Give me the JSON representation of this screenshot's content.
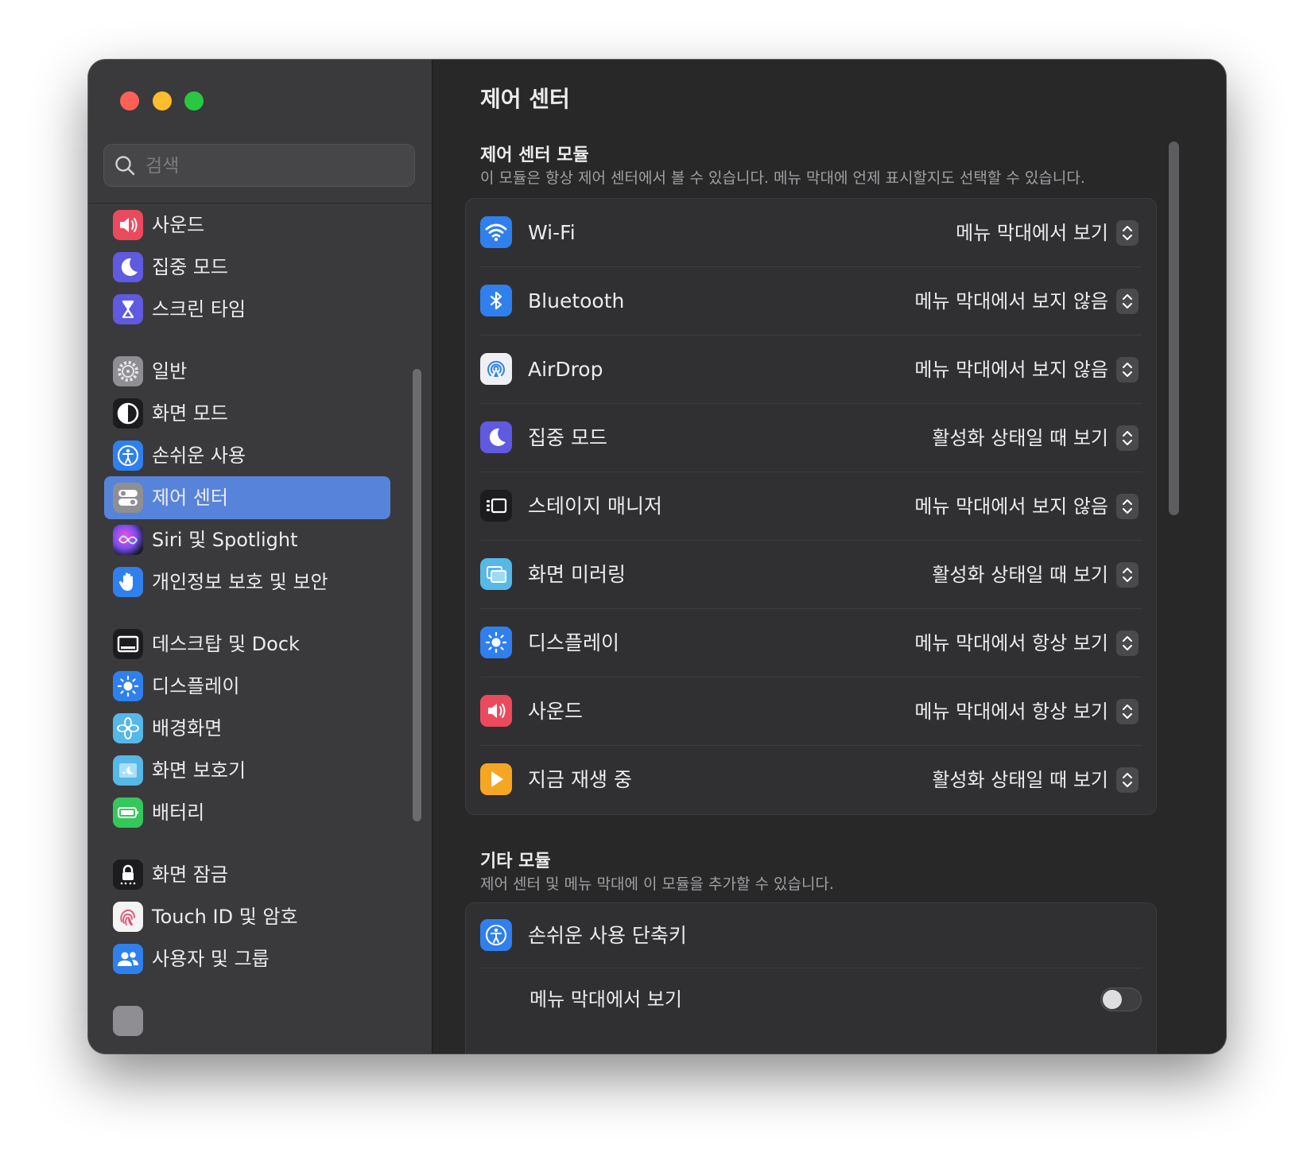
{
  "sidebar": {
    "search_placeholder": "검색",
    "items": [
      {
        "label": "사운드",
        "icon": "speaker-icon",
        "color": "#eb4a5e"
      },
      {
        "label": "집중 모드",
        "icon": "moon-icon",
        "color": "#5f5ae0"
      },
      {
        "label": "스크린 타임",
        "icon": "hourglass-icon",
        "color": "#5f5ae0"
      },
      {
        "label": "일반",
        "icon": "gear-icon",
        "color": "#8e8e93"
      },
      {
        "label": "화면 모드",
        "icon": "appearance-icon",
        "color": "#1c1c1e"
      },
      {
        "label": "손쉬운 사용",
        "icon": "accessibility-icon",
        "color": "#2f80ed"
      },
      {
        "label": "제어 센터",
        "icon": "control-center-icon",
        "color": "#8e8e93",
        "active": true
      },
      {
        "label": "Siri 및 Spotlight",
        "icon": "siri-icon",
        "color": "#9b4fd6"
      },
      {
        "label": "개인정보 보호 및 보안",
        "icon": "hand-icon",
        "color": "#2f80ed"
      },
      {
        "label": "데스크탑 및 Dock",
        "icon": "dock-icon",
        "color": "#1c1c1e"
      },
      {
        "label": "디스플레이",
        "icon": "sun-icon",
        "color": "#2f80ed"
      },
      {
        "label": "배경화면",
        "icon": "flower-icon",
        "color": "#56b8e6"
      },
      {
        "label": "화면 보호기",
        "icon": "screensaver-icon",
        "color": "#56b8e6"
      },
      {
        "label": "배터리",
        "icon": "battery-icon",
        "color": "#35c759"
      },
      {
        "label": "화면 잠금",
        "icon": "lock-icon",
        "color": "#1c1c1e"
      },
      {
        "label": "Touch ID 및 암호",
        "icon": "fingerprint-icon",
        "color": "#f4f4f4"
      },
      {
        "label": "사용자 및 그룹",
        "icon": "users-icon",
        "color": "#2f80ed"
      }
    ]
  },
  "main": {
    "title": "제어 센터",
    "modules_section": {
      "title": "제어 센터 모듈",
      "description": "이 모듈은 항상 제어 센터에서 볼 수 있습니다. 메뉴 막대에 언제 표시할지도 선택할 수 있습니다.",
      "rows": [
        {
          "name": "Wi-Fi",
          "value": "메뉴 막대에서 보기",
          "icon": "wifi-icon",
          "color": "#2f80ed"
        },
        {
          "name": "Bluetooth",
          "value": "메뉴 막대에서 보지 않음",
          "icon": "bluetooth-icon",
          "color": "#2f80ed"
        },
        {
          "name": "AirDrop",
          "value": "메뉴 막대에서 보지 않음",
          "icon": "airdrop-icon",
          "color": "#eef0f4"
        },
        {
          "name": "집중 모드",
          "value": "활성화 상태일 때 보기",
          "icon": "moon-icon",
          "color": "#5f5ae0"
        },
        {
          "name": "스테이지 매니저",
          "value": "메뉴 막대에서 보지 않음",
          "icon": "stage-manager-icon",
          "color": "#1c1c1e"
        },
        {
          "name": "화면 미러링",
          "value": "활성화 상태일 때 보기",
          "icon": "screen-mirroring-icon",
          "color": "#56b8e6"
        },
        {
          "name": "디스플레이",
          "value": "메뉴 막대에서 항상 보기",
          "icon": "sun-icon",
          "color": "#2f80ed"
        },
        {
          "name": "사운드",
          "value": "메뉴 막대에서 항상 보기",
          "icon": "speaker-icon",
          "color": "#eb4a5e"
        },
        {
          "name": "지금 재생 중",
          "value": "활성화 상태일 때 보기",
          "icon": "play-icon",
          "color": "#f5a623"
        }
      ]
    },
    "other_section": {
      "title": "기타 모듈",
      "description": "제어 센터 및 메뉴 막대에 이 모듈을 추가할 수 있습니다.",
      "rows": [
        {
          "name": "손쉬운 사용 단축키",
          "icon": "accessibility-icon",
          "color": "#2f80ed"
        },
        {
          "name": "메뉴 막대에서 보기",
          "toggle": false
        }
      ]
    }
  }
}
